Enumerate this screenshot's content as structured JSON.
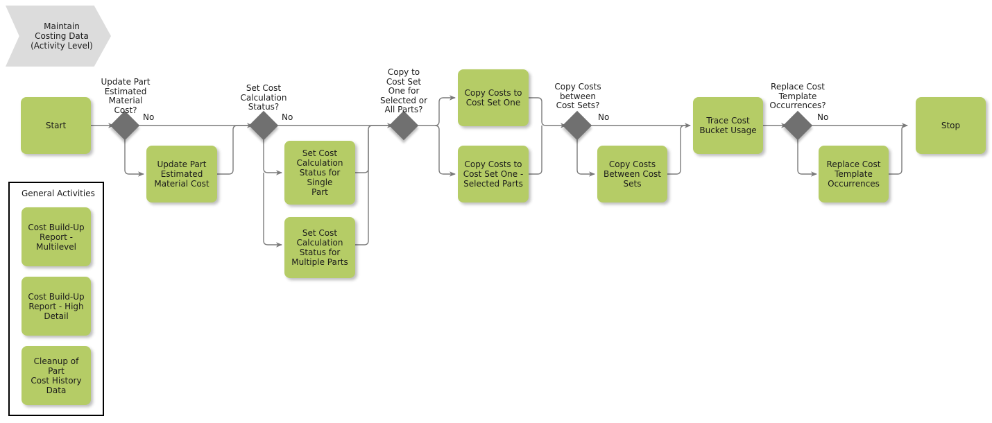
{
  "diagram": {
    "title": "Maintain\nCosting Data\n(Activity Level)",
    "colors": {
      "activity_fill": "#b5cc66",
      "decision_fill": "#707070",
      "header_fill": "#dcdcdc",
      "line": "#7a7a7a",
      "text": "#1a1a1a",
      "panel_border": "#000000",
      "background": "#ffffff"
    }
  },
  "nodes": {
    "start": "Start",
    "update_part_estimated_material_cost": "Update Part\nEstimated\nMaterial Cost",
    "set_cost_calc_status_single": "Set Cost\nCalculation\nStatus for Single\nPart",
    "set_cost_calc_status_multiple": "Set Cost\nCalculation\nStatus for\nMultiple Parts",
    "copy_costs_to_cost_set_one": "Copy Costs to\nCost Set One",
    "copy_costs_to_cost_set_one_selected": "Copy Costs to\nCost Set One -\nSelected Parts",
    "copy_costs_between_cost_sets": "Copy Costs\nBetween Cost\nSets",
    "trace_cost_bucket_usage": "Trace Cost\nBucket Usage",
    "replace_cost_template_occurrences": "Replace Cost\nTemplate\nOccurrences",
    "stop": "Stop"
  },
  "decisions": {
    "update_part_estimated_material_cost_q": "Update Part\nEstimated\nMaterial\nCost?",
    "set_cost_calculation_status_q": "Set Cost\nCalculation\nStatus?",
    "copy_to_cost_set_one_q": "Copy to\nCost Set\nOne for\nSelected or\nAll Parts?",
    "copy_costs_between_cost_sets_q": "Copy Costs\nbetween\nCost Sets?",
    "replace_cost_template_occurrences_q": "Replace Cost\nTemplate\nOccurrences?"
  },
  "edge_labels": {
    "no_1": "No",
    "no_2": "No",
    "no_3": "No",
    "no_4": "No"
  },
  "general_activities": {
    "title": "General Activities",
    "items": [
      "Cost Build-Up\nReport -\nMultilevel",
      "Cost Build-Up\nReport - High\nDetail",
      "Cleanup of Part\nCost History\nData"
    ]
  }
}
